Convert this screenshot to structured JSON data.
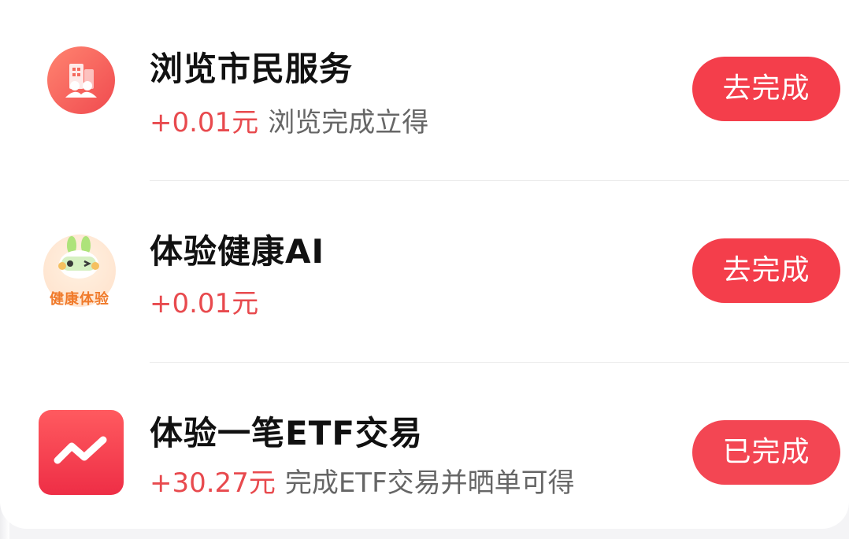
{
  "tasks": [
    {
      "title": "浏览市民服务",
      "reward": "+0.01元",
      "description": "浏览完成立得",
      "button_label": "去完成",
      "icon": "city-services-icon"
    },
    {
      "title": "体验健康AI",
      "reward": "+0.01元",
      "description": "",
      "button_label": "去完成",
      "icon": "health-ai-icon",
      "icon_text": "健康体验"
    },
    {
      "title": "体验一笔ETF交易",
      "reward": "+30.27元",
      "description": "完成ETF交易并晒单可得",
      "button_label": "已完成",
      "icon": "stock-trend-icon"
    }
  ],
  "colors": {
    "accent": "#f43e4b",
    "reward": "#e84a4e",
    "health_icon_text": "#f07a2a"
  }
}
